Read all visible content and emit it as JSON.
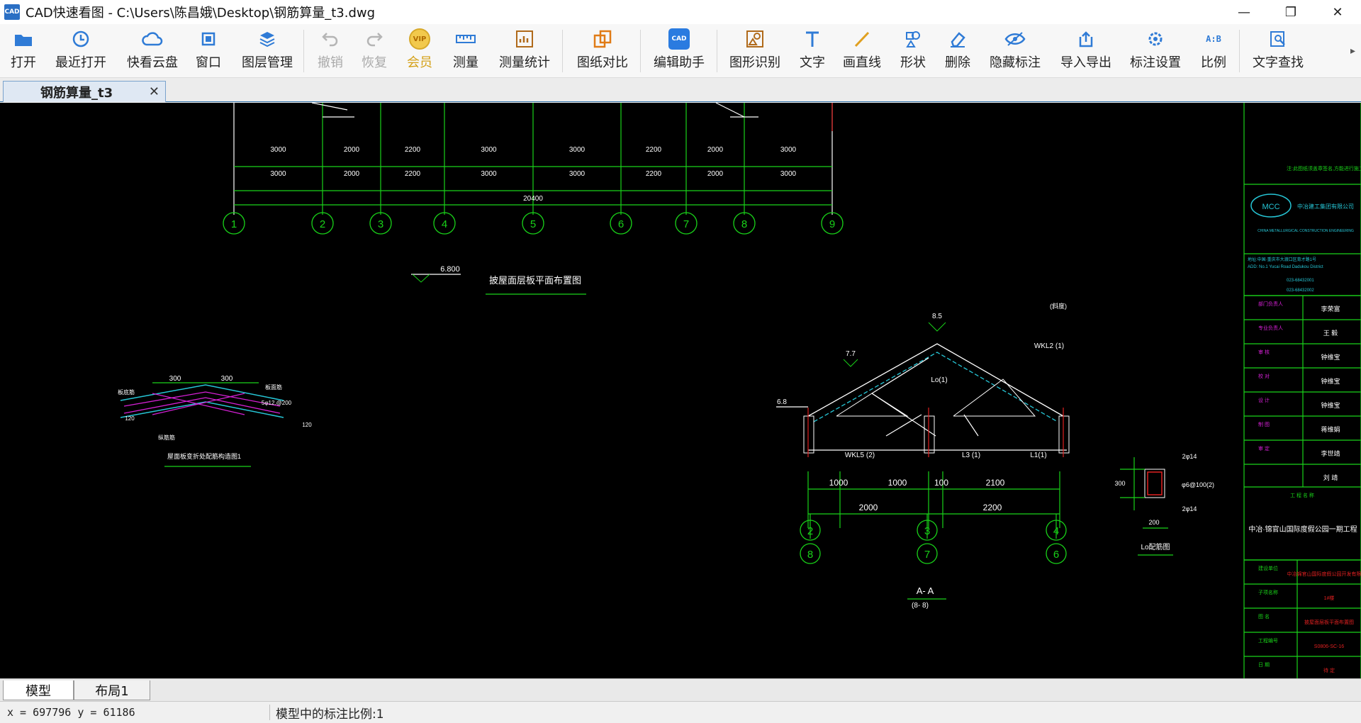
{
  "window": {
    "title": "CAD快速看图 - C:\\Users\\陈昌娥\\Desktop\\钢筋算量_t3.dwg",
    "logo_text": "CAD",
    "minimize": "—",
    "restore": "❐",
    "close": "✕"
  },
  "toolbar": {
    "items": [
      {
        "label": "打开",
        "icon": "folder-open-icon"
      },
      {
        "label": "最近打开",
        "icon": "recent-icon"
      },
      {
        "label": "快看云盘",
        "icon": "cloud-icon"
      },
      {
        "label": "窗口",
        "icon": "window-icon"
      },
      {
        "label": "图层管理",
        "icon": "layers-icon"
      },
      {
        "label": "撤销",
        "icon": "undo-icon"
      },
      {
        "label": "恢复",
        "icon": "redo-icon"
      },
      {
        "label": "会员",
        "icon": "vip-icon"
      },
      {
        "label": "测量",
        "icon": "ruler-icon"
      },
      {
        "label": "测量统计",
        "icon": "measure-stats-icon"
      },
      {
        "label": "图纸对比",
        "icon": "compare-icon"
      },
      {
        "label": "编辑助手",
        "icon": "edit-assistant-icon"
      },
      {
        "label": "图形识别",
        "icon": "shape-recognition-icon"
      },
      {
        "label": "文字",
        "icon": "text-icon"
      },
      {
        "label": "画直线",
        "icon": "line-icon"
      },
      {
        "label": "形状",
        "icon": "shapes-icon"
      },
      {
        "label": "删除",
        "icon": "eraser-icon"
      },
      {
        "label": "隐藏标注",
        "icon": "hide-icon"
      },
      {
        "label": "导入导出",
        "icon": "import-export-icon"
      },
      {
        "label": "标注设置",
        "icon": "annotation-settings-icon"
      },
      {
        "label": "比例",
        "icon": "scale-icon"
      },
      {
        "label": "文字查找",
        "icon": "text-search-icon"
      }
    ],
    "more": "▸",
    "vip_badge": "VIP",
    "edit_badge": "CAD",
    "scale_badge": "A:B"
  },
  "document_tab": {
    "label": "钢筋算量_t3",
    "close": "✕"
  },
  "drawing": {
    "top_dims_row1": [
      "3000",
      "2000",
      "2200",
      "3000",
      "3000",
      "2200",
      "2000",
      "3000"
    ],
    "top_dims_row2": [
      "3000",
      "2000",
      "2200",
      "3000",
      "3000",
      "2200",
      "2000",
      "3000"
    ],
    "top_total": "20400",
    "top_axes": [
      "1",
      "2",
      "3",
      "4",
      "5",
      "6",
      "7",
      "8",
      "9"
    ],
    "elevation_mark": "6.800",
    "plan_title": "披屋面层板平面布置图",
    "detail_title": "屋面板变折处配筋构造图1",
    "detail_dims": [
      "300",
      "300"
    ],
    "detail_labels": [
      "板底筋",
      "板面筋",
      "5φ12.@200",
      "120",
      "120",
      "纵筋筋"
    ],
    "section_note": "(斜度)",
    "section_elevations": [
      "8.5",
      "7.7",
      "6.8"
    ],
    "section_beams": [
      "WKL2 (1)",
      "Lo(1)",
      "WKL5 (2)",
      "L3 (1)",
      "L1(1)"
    ],
    "section_dims_upper": [
      "1000",
      "1000",
      "100",
      "2100"
    ],
    "section_dims_lower": [
      "2000",
      "2200"
    ],
    "section_axes_top": [
      "2",
      "3",
      "4"
    ],
    "section_axes_bottom": [
      "8",
      "7",
      "6"
    ],
    "section_title": "A- A",
    "section_subtitle": "(8- 8)",
    "lo_detail_title": "Lo配筋图",
    "lo_detail_labels": [
      "2φ14",
      "φ6@100(2)",
      "2φ14",
      "300",
      "200"
    ],
    "title_block": {
      "note": "注:此图纸须盖章签名,方能进行施工",
      "company_logo": "MCC",
      "company_cn": "中冶建工集团有限公司",
      "company_en": "CHINA METALLURGICAL CONSTRUCTION ENGINEERING",
      "address": "地址:中国·重庆市大渡口区育才路1号",
      "address_en": "ADD: No.1 Yucai Road Dadukou District",
      "tel": "023-68432001",
      "fax": "023-68432002",
      "roles": [
        "部门负责人",
        "专业负责人",
        "审 核",
        "校 对",
        "设 计",
        "制 图",
        "审 定"
      ],
      "names": [
        "李荣富",
        "王 毅",
        "钟维宝",
        "钟维宝",
        "钟维宝",
        "蒋维娟",
        "李世靖",
        "刘 靖"
      ],
      "stamp_label": "工 程 名 称",
      "project_name": "中冶·锦官山国际度假公园一期工程",
      "sheet_rows": [
        "建设单位",
        "子项名称",
        "图 名",
        "工程编号",
        "日 期"
      ],
      "sheet_values": [
        "中冶锦官山国际度假公园开发有限公司",
        "1#楼",
        "披屋面层板平面布置图",
        "S0806-SC-16",
        "待 定"
      ]
    }
  },
  "layout_tabs": [
    {
      "label": "模型",
      "active": true
    },
    {
      "label": "布局1",
      "active": false
    }
  ],
  "status": {
    "coords": "x = 697796 y = 61186",
    "scale_text": "模型中的标注比例:1"
  }
}
